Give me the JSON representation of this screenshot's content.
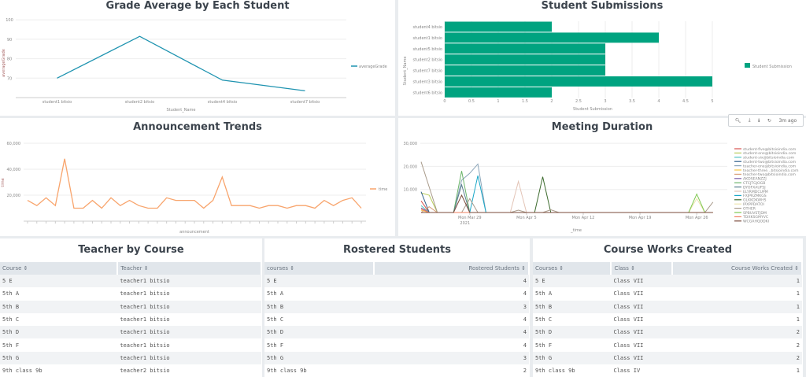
{
  "chart_data": [
    {
      "type": "line",
      "title": "Grade Average by Each Student",
      "xlabel": "Student_Name",
      "ylabel": "averageGrade",
      "categories": [
        "student1 bitsio",
        "student2 bitsio",
        "student4 bitsio",
        "student7 bitsio"
      ],
      "series": [
        {
          "name": "averageGrade",
          "values": [
            70,
            91.5,
            69,
            63.5
          ],
          "color": "#1e93b0"
        }
      ],
      "ylim": [
        60,
        100
      ],
      "yticks": [
        "70",
        "80",
        "90",
        "100"
      ],
      "legend": "right",
      "grid": true
    },
    {
      "type": "bar",
      "orientation": "horizontal",
      "title": "Student Submissions",
      "xlabel": "Student Submission",
      "ylabel": "Student_Name",
      "categories": [
        "student4 bitsio",
        "student1 bitsio",
        "student5 bitsio",
        "student2 bitsio",
        "student7 bitsio",
        "student3 bitsio",
        "student6 bitsio"
      ],
      "series": [
        {
          "name": "Student Submission",
          "values": [
            2,
            4,
            3,
            3,
            3,
            5,
            2
          ],
          "color": "#00a380"
        }
      ],
      "xlim": [
        0,
        5.5
      ],
      "xticks": [
        "0",
        "0.5",
        "1",
        "1.5",
        "2",
        "2.5",
        "3",
        "3.5",
        "4",
        "4.5",
        "5"
      ],
      "legend": "right",
      "grid": true
    },
    {
      "type": "line",
      "title": "Announcement Trends",
      "xlabel": "announcement",
      "ylabel": "time",
      "series": [
        {
          "name": "time",
          "color": "#f8a46c",
          "values": [
            16000,
            12000,
            18000,
            12000,
            48000,
            10000,
            10000,
            16000,
            10000,
            18000,
            12000,
            16000,
            12000,
            10000,
            10000,
            18000,
            16000,
            16000,
            16000,
            10000,
            16000,
            34000,
            12000,
            12000,
            12000,
            10000,
            12000,
            12000,
            10000,
            12000,
            12000,
            10000,
            16000,
            12000,
            16000,
            18000,
            10000
          ]
        }
      ],
      "ylim": [
        0,
        60000
      ],
      "yticks": [
        "20,000",
        "40,000",
        "60,000"
      ],
      "legend": "right",
      "grid": true
    },
    {
      "type": "line",
      "title": "Meeting Duration",
      "xlabel": "_time",
      "xlim": [
        "2021-03-23",
        "2021-04-28"
      ],
      "xticks": [
        {
          "date": "2021-03-29",
          "label": "Mon Mar 29",
          "sub": "2021"
        },
        {
          "date": "2021-04-05",
          "label": "Mon Apr 5"
        },
        {
          "date": "2021-04-12",
          "label": "Mon Apr 12"
        },
        {
          "date": "2021-04-19",
          "label": "Mon Apr 19"
        },
        {
          "date": "2021-04-26",
          "label": "Mon Apr 26"
        }
      ],
      "ylim": [
        0,
        30000
      ],
      "yticks": [
        "10,000",
        "20,000",
        "30,000"
      ],
      "legend": "right",
      "grid": true,
      "series": [
        {
          "name": "student-five@bitsioindia.com",
          "color": "#d9534f",
          "points": [
            [
              "2021-03-23",
              5000
            ]
          ]
        },
        {
          "name": "student-one@bitsioindia.com",
          "color": "#b8cc5a",
          "points": [
            [
              "2021-03-23",
              8500
            ],
            [
              "2021-03-24",
              7500
            ]
          ]
        },
        {
          "name": "student-six@bitsioindia.com",
          "color": "#4fc3c3",
          "points": [
            [
              "2021-03-23",
              3000
            ]
          ]
        },
        {
          "name": "student-two@bitsioindia.com",
          "color": "#2f5f8a",
          "points": [
            [
              "2021-03-23",
              9000
            ]
          ]
        },
        {
          "name": "teacher-one@bitsioindia.com",
          "color": "#8aa4b8",
          "points": [
            [
              "2021-03-28",
              14000
            ],
            [
              "2021-03-29",
              17000
            ],
            [
              "2021-03-30",
              21000
            ]
          ]
        },
        {
          "name": "teacher-three...bitsioindia.com",
          "color": "#f5c542",
          "points": [
            [
              "2021-03-23",
              1000
            ]
          ]
        },
        {
          "name": "teacher-two@bitsioindia.com",
          "color": "#d9a07a",
          "points": [
            [
              "2021-03-24",
              2500
            ]
          ]
        },
        {
          "name": "AKDSEANZZJ",
          "color": "#7b5ea7",
          "points": [
            [
              "2021-03-23",
              2000
            ]
          ]
        },
        {
          "name": "CTCJTGJOGB",
          "color": "#6bb56b",
          "points": [
            [
              "2021-03-28",
              18000
            ]
          ]
        },
        {
          "name": "DYOFXAUFSJ",
          "color": "#5a7f8f",
          "points": [
            [
              "2021-03-28",
              12000
            ]
          ]
        },
        {
          "name": "ELYRMDCUPM",
          "color": "#e3c4b6",
          "points": [
            [
              "2021-04-04",
              13500
            ]
          ]
        },
        {
          "name": "FXJPRZMKGS",
          "color": "#1aa7c7",
          "points": [
            [
              "2021-03-30",
              16000
            ]
          ]
        },
        {
          "name": "GLKKDKWHS",
          "color": "#3d6b2e",
          "points": [
            [
              "2021-04-07",
              15500
            ]
          ]
        },
        {
          "name": "IPXPPDATOI",
          "color": "#efe6b0",
          "points": [
            [
              "2021-04-26",
              6000
            ]
          ]
        },
        {
          "name": "OTHER",
          "color": "#a89a8a",
          "points": [
            [
              "2021-03-23",
              22000
            ],
            [
              "2021-03-24",
              11000
            ],
            [
              "2021-03-29",
              6000
            ],
            [
              "2021-04-04",
              1000
            ],
            [
              "2021-04-08",
              1200
            ],
            [
              "2021-04-28",
              4500
            ]
          ]
        },
        {
          "name": "SPBUVSTJDM",
          "color": "#7ec850",
          "points": [
            [
              "2021-04-26",
              8000
            ]
          ]
        },
        {
          "name": "TDXKSGMYVC",
          "color": "#f08060",
          "points": [
            [
              "2021-03-23",
              1500
            ]
          ]
        },
        {
          "name": "WCGAHQODKI",
          "color": "#7a4a3a",
          "points": [
            [
              "2021-03-28",
              7500
            ]
          ]
        }
      ]
    }
  ],
  "toolbar": {
    "refreshed": "3m ago"
  },
  "tables": [
    {
      "title": "Teacher by Course",
      "columns": [
        "Course ⇕",
        "Teacher ⇕"
      ],
      "align": [
        "l",
        "l"
      ],
      "rows": [
        [
          "5 E",
          "teacher1 bitsio"
        ],
        [
          "5th A",
          "teacher1 bitsio"
        ],
        [
          "5th B",
          "teacher1 bitsio"
        ],
        [
          "5th C",
          "teacher1 bitsio"
        ],
        [
          "5th D",
          "teacher1 bitsio"
        ],
        [
          "5th F",
          "teacher1 bitsio"
        ],
        [
          "5th G",
          "teacher1 bitsio"
        ],
        [
          "9th class 9b",
          "teacher2 bitsio"
        ]
      ]
    },
    {
      "title": "Rostered Students",
      "columns": [
        "courses ⇕",
        "Rostered Students ⇕"
      ],
      "align": [
        "l",
        "r"
      ],
      "rows": [
        [
          "5 E",
          "4"
        ],
        [
          "5th A",
          "4"
        ],
        [
          "5th B",
          "3"
        ],
        [
          "5th C",
          "4"
        ],
        [
          "5th D",
          "4"
        ],
        [
          "5th F",
          "4"
        ],
        [
          "5th G",
          "3"
        ],
        [
          "9th class 9b",
          "2"
        ]
      ]
    },
    {
      "title": "Course Works Created",
      "columns": [
        "Courses ⇕",
        "Class ⇕",
        "Course Works Created ⇕"
      ],
      "align": [
        "l",
        "l",
        "r"
      ],
      "rows": [
        [
          "5 E",
          "Class VII",
          "1"
        ],
        [
          "5th A",
          "Class VII",
          "1"
        ],
        [
          "5th B",
          "Class VII",
          "1"
        ],
        [
          "5th C",
          "Class VII",
          "1"
        ],
        [
          "5th D",
          "Class VII",
          "2"
        ],
        [
          "5th F",
          "Class VII",
          "2"
        ],
        [
          "5th G",
          "Class VII",
          "2"
        ],
        [
          "9th class 9b",
          "Class IV",
          "1"
        ]
      ]
    }
  ]
}
